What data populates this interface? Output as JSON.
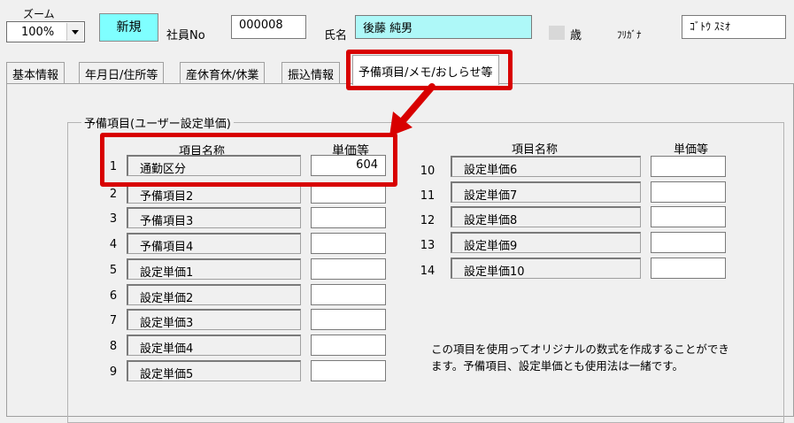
{
  "header": {
    "zoom_label": "ズーム",
    "zoom_value": "100%",
    "new_button": "新規",
    "employee_no_label": "社員No",
    "employee_no": "000008",
    "name_label": "氏名",
    "name": "後藤 純男",
    "age_unit": "歳",
    "furigana_label": "ﾌﾘｶﾞﾅ",
    "furigana": "ｺﾞﾄｳ ｽﾐｵ"
  },
  "tabs": [
    {
      "label": "基本情報"
    },
    {
      "label": "年月日/住所等"
    },
    {
      "label": "産休育休/休業"
    },
    {
      "label": "振込情報"
    },
    {
      "label": "予備項目/メモ/おしらせ等"
    }
  ],
  "group": {
    "title": "予備項目(ユーザー設定単価)",
    "col_item_name": "項目名称",
    "col_unit_price": "単価等",
    "rows": [
      {
        "no": "1",
        "name": "通勤区分",
        "price": "604"
      },
      {
        "no": "2",
        "name": "予備項目2",
        "price": ""
      },
      {
        "no": "3",
        "name": "予備項目3",
        "price": ""
      },
      {
        "no": "4",
        "name": "予備項目4",
        "price": ""
      },
      {
        "no": "5",
        "name": "設定単価1",
        "price": ""
      },
      {
        "no": "6",
        "name": "設定単価2",
        "price": ""
      },
      {
        "no": "7",
        "name": "設定単価3",
        "price": ""
      },
      {
        "no": "8",
        "name": "設定単価4",
        "price": ""
      },
      {
        "no": "9",
        "name": "設定単価5",
        "price": ""
      },
      {
        "no": "10",
        "name": "設定単価6",
        "price": ""
      },
      {
        "no": "11",
        "name": "設定単価7",
        "price": ""
      },
      {
        "no": "12",
        "name": "設定単価8",
        "price": ""
      },
      {
        "no": "13",
        "name": "設定単価9",
        "price": ""
      },
      {
        "no": "14",
        "name": "設定単価10",
        "price": ""
      }
    ],
    "note_line1": "この項目を使用ってオリジナルの数式を作成することができ",
    "note_line2": "ます。予備項目、設定単価とも使用法は一緒です。"
  },
  "colors": {
    "highlight": "#d80000",
    "new_button_bg": "#7fffff",
    "name_field_bg": "#aef8f8"
  }
}
